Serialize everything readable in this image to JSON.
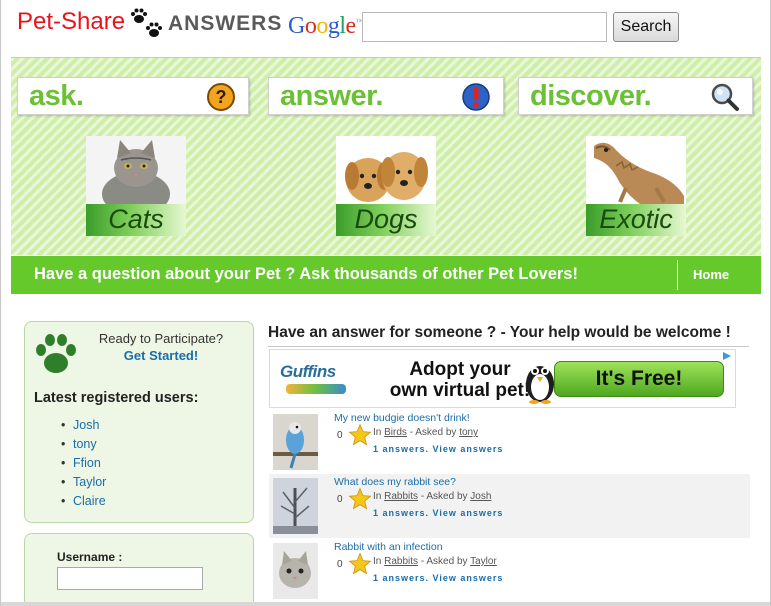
{
  "header": {
    "brand": "Pet-Share",
    "brand_suffix": "ANSWERS",
    "google_text": "Google",
    "google_tm": "™",
    "search": {
      "value": "",
      "placeholder": ""
    },
    "search_button": "Search"
  },
  "banner": {
    "actions": [
      {
        "label": "ask.",
        "icon": "question-icon"
      },
      {
        "label": "answer.",
        "icon": "exclamation-icon"
      },
      {
        "label": "discover.",
        "icon": "magnifier-icon"
      }
    ],
    "categories": [
      {
        "label": "Cats",
        "image": "cat-photo"
      },
      {
        "label": "Dogs",
        "image": "puppies-photo"
      },
      {
        "label": "Exotic",
        "image": "lizard-photo"
      }
    ]
  },
  "strip": {
    "tagline": "Have a question about your Pet ? Ask thousands of other Pet Lovers!",
    "home": "Home"
  },
  "sidebar": {
    "ready": "Ready to Participate?",
    "get_started": "Get Started!",
    "latest_title": "Latest registered users:",
    "users": [
      "Josh",
      "tony",
      "Ffion",
      "Taylor",
      "Claire"
    ],
    "username_label": "Username :",
    "username_value": ""
  },
  "main": {
    "help_heading": "Have an answer for someone ? - Your help would be welcome !",
    "ad": {
      "brand": "Guffins",
      "line1": "Adopt your",
      "line2": "own virtual pet!",
      "cta": "It's Free!"
    },
    "questions": [
      {
        "title": "My new budgie doesn't drink!",
        "votes": "0",
        "in_label": "In",
        "category": "Birds",
        "asked_by_label": "- Asked by",
        "user": "tony",
        "answers": "1 answers. View answers",
        "thumb": "budgie-photo"
      },
      {
        "title": "What does my rabbit see?",
        "votes": "0",
        "in_label": "In",
        "category": "Rabbits",
        "asked_by_label": "- Asked by",
        "user": "Josh",
        "answers": "1 answers. View answers",
        "thumb": "rabbit-tree-photo"
      },
      {
        "title": "Rabbit with an infection",
        "votes": "0",
        "in_label": "In",
        "category": "Rabbits",
        "asked_by_label": "- Asked by",
        "user": "Taylor",
        "answers": "1 answers. View answers",
        "thumb": "kitten-photo"
      }
    ]
  },
  "colors": {
    "brand_red": "#e8141b",
    "accent_green": "#66c92b",
    "banner_green": "#cfeeaa",
    "link_blue": "#1b6da8"
  }
}
